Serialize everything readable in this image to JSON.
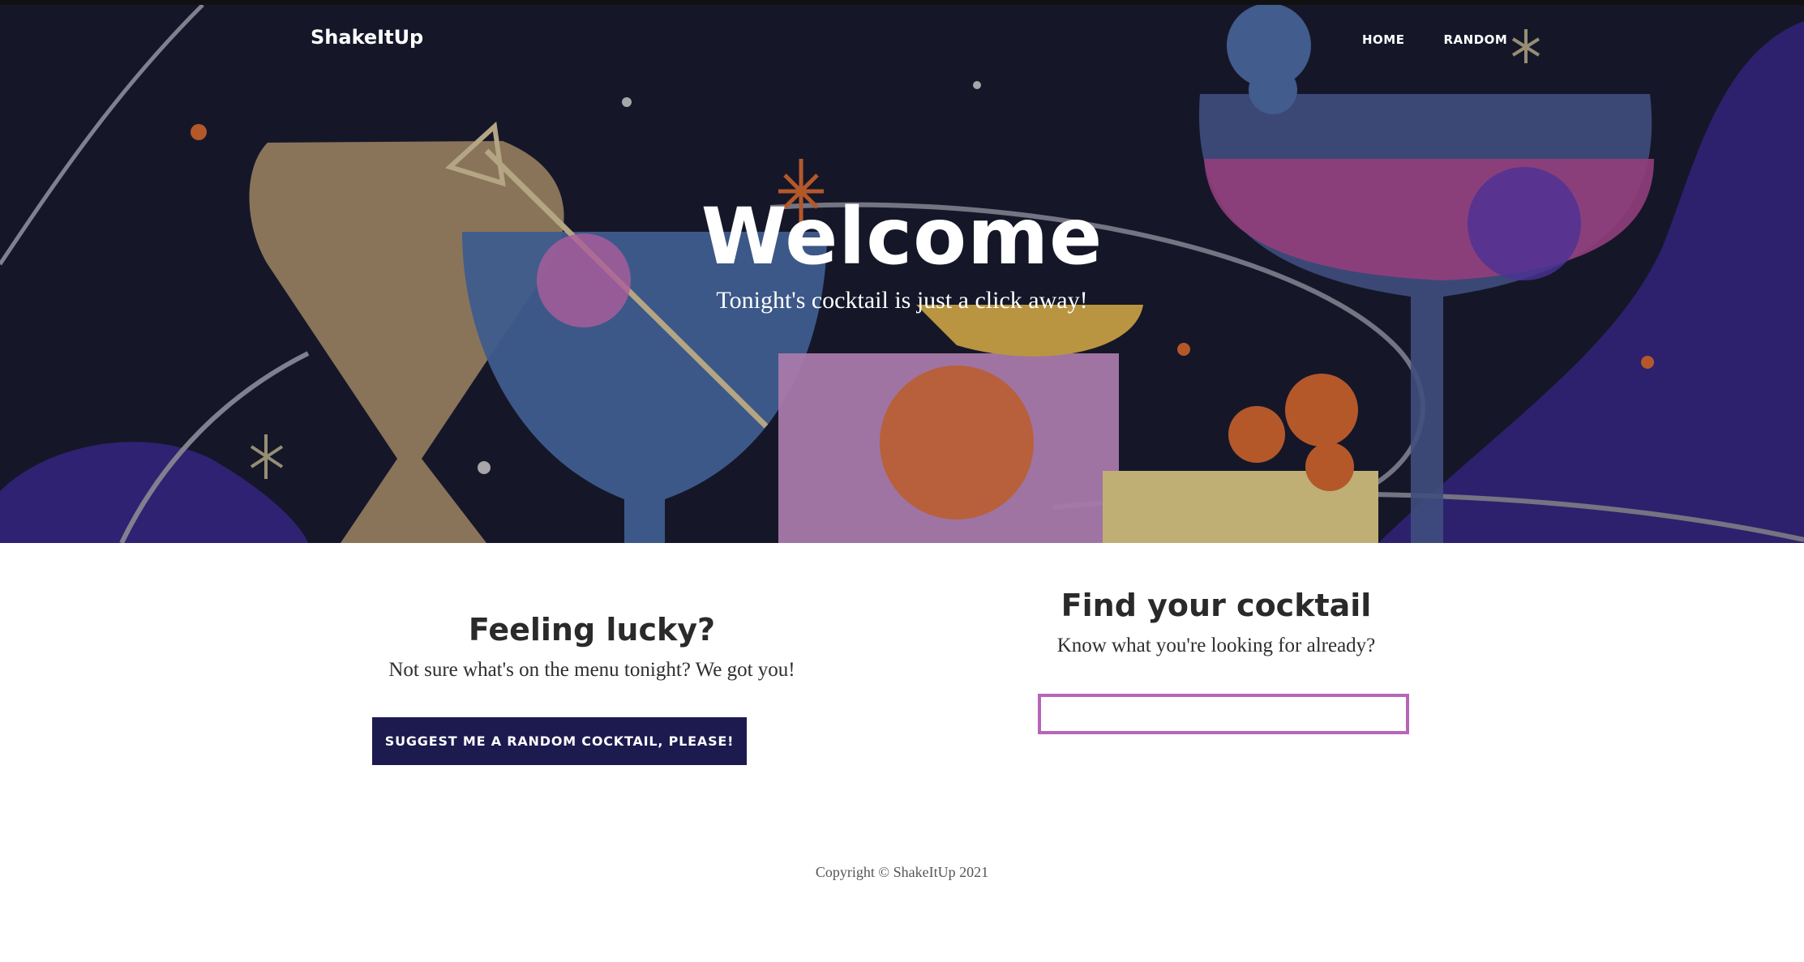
{
  "navbar": {
    "brand": "ShakeItUp",
    "links": [
      {
        "label": "HOME"
      },
      {
        "label": "RANDOM"
      }
    ]
  },
  "hero": {
    "title": "Welcome",
    "subtitle": "Tonight's cocktail is just a click away!"
  },
  "lucky": {
    "heading": "Feeling lucky?",
    "text": "Not sure what's on the menu tonight? We got you!",
    "button_label": "SUGGEST ME A RANDOM COCKTAIL, PLEASE!"
  },
  "find": {
    "heading": "Find your cocktail",
    "text": "Know what you're looking for already?",
    "search_value": "",
    "search_placeholder": ""
  },
  "footer": {
    "copyright": "Copyright © ShakeItUp 2021"
  },
  "colors": {
    "hero_background": "#181a2c",
    "button_background": "#1c1a4f",
    "search_border": "#b865b9"
  }
}
